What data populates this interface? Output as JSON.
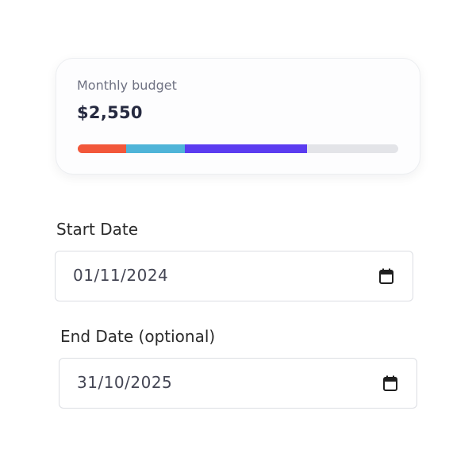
{
  "budget": {
    "label": "Monthly budget",
    "amount": "$2,550",
    "segments": [
      {
        "name": "segment-1",
        "fraction": 0.152,
        "color": "#f2573a"
      },
      {
        "name": "segment-2",
        "fraction": 0.183,
        "color": "#4fb4d8"
      },
      {
        "name": "segment-3",
        "fraction": 0.381,
        "color": "#5b3cf0"
      }
    ],
    "track_color": "#e3e4e8"
  },
  "start_date": {
    "label": "Start Date",
    "value": "01/11/2024",
    "icon": "calendar-icon"
  },
  "end_date": {
    "label": "End Date (optional)",
    "value": "31/10/2025",
    "icon": "calendar-icon"
  }
}
